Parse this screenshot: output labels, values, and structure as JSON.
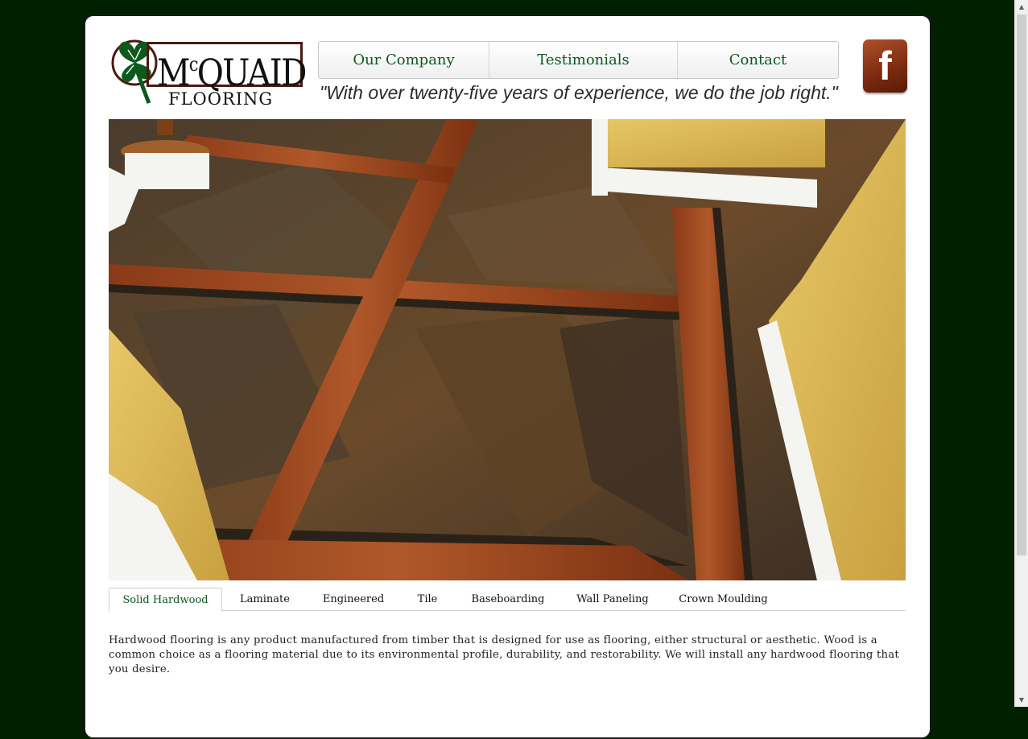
{
  "logo": {
    "brand": "McQUAID",
    "sub": "FLOORING"
  },
  "nav": [
    {
      "label": "Our Company"
    },
    {
      "label": "Testimonials"
    },
    {
      "label": "Contact"
    }
  ],
  "tagline": "\"With over twenty-five years of experience, we do the job right.\"",
  "social": {
    "facebook_icon": "facebook-icon",
    "letter": "f"
  },
  "hero": {
    "alt": "slate tile and hardwood floor photo"
  },
  "tabs": [
    {
      "label": "Solid Hardwood",
      "active": true
    },
    {
      "label": "Laminate"
    },
    {
      "label": "Engineered"
    },
    {
      "label": "Tile"
    },
    {
      "label": "Baseboarding"
    },
    {
      "label": "Wall Paneling"
    },
    {
      "label": "Crown Moulding"
    }
  ],
  "description": "Hardwood flooring is any product manufactured from timber that is designed for use as flooring, either structural or aesthetic. Wood is a common choice as a flooring material due to its environmental profile, durability, and restorability. We will install any hardwood flooring that you desire.",
  "colors": {
    "background": "#002000",
    "nav_text": "#0c5a1e",
    "accent": "#0c5a1e"
  }
}
